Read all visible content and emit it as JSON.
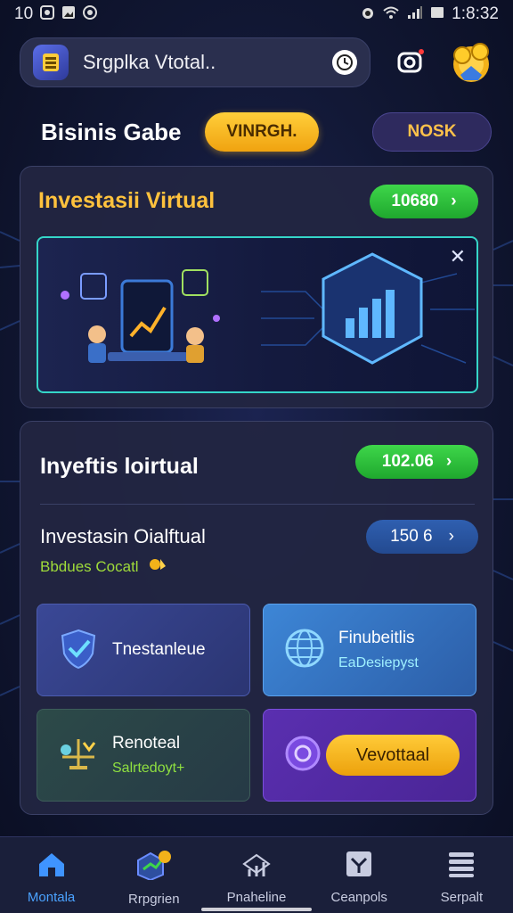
{
  "status_bar": {
    "left_text": "10",
    "time": "1:8:32"
  },
  "topbar": {
    "app_title": "Srgplka Vtotal.."
  },
  "header": {
    "game_title": "Bisinis Gabe",
    "yellow_pill": "VINRGH.",
    "purple_pill": "NOSK"
  },
  "card1": {
    "title": "Investasii Virtual",
    "value_pill": "10680"
  },
  "card2": {
    "title": "Inyeftis loirtual",
    "value_pill": "102.06",
    "investment_title": "Investasin Oialftual",
    "investment_sub": "Bbdues Cocatl",
    "investment_value": "150 6",
    "tiles": [
      {
        "title": "Tnestanleue",
        "subtitle": ""
      },
      {
        "title": "Finubeitlis",
        "subtitle": "EaDesiepyst"
      },
      {
        "title": "Renoteal",
        "subtitle": "Salrtedoyt+"
      },
      {
        "title": "",
        "button": "Vevottaal"
      }
    ]
  },
  "bottom_nav": [
    {
      "label": "Montala",
      "icon": "home-icon",
      "active": true
    },
    {
      "label": "Rrpgrien",
      "icon": "investment-icon",
      "active": false
    },
    {
      "label": "Pnaheline",
      "icon": "chart-icon",
      "active": false
    },
    {
      "label": "Ceanpols",
      "icon": "inbox-icon",
      "active": false
    },
    {
      "label": "Serpalt",
      "icon": "menu-icon",
      "active": false
    }
  ],
  "colors": {
    "accent_yellow": "#ffc23d",
    "accent_green": "#2fc23c",
    "accent_blue": "#4aa2ff",
    "banner_border": "#35d6c8"
  }
}
